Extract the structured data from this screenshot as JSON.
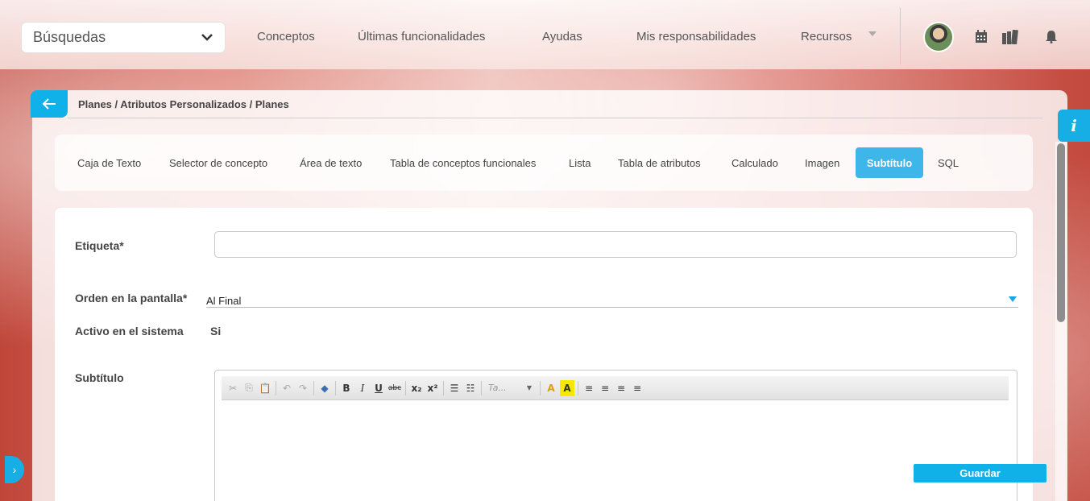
{
  "header": {
    "search_value": "Búsquedas",
    "nav": [
      {
        "label": "Conceptos"
      },
      {
        "label": "Últimas funcionalidades"
      },
      {
        "label": "Ayudas"
      },
      {
        "label": "Mis responsabilidades"
      },
      {
        "label": "Recursos"
      }
    ],
    "icons": [
      "chevron-down-icon",
      "avatar",
      "calendar-icon",
      "books-icon",
      "bell-icon"
    ]
  },
  "breadcrumb": "Planes / Atributos Personalizados / Planes",
  "tabs": [
    {
      "label": "Caja de Texto"
    },
    {
      "label": "Selector de concepto"
    },
    {
      "label": "Área de texto"
    },
    {
      "label": "Tabla de conceptos funcionales"
    },
    {
      "label": "Lista"
    },
    {
      "label": "Tabla de atributos"
    },
    {
      "label": "Calculado"
    },
    {
      "label": "Imagen"
    },
    {
      "label": "Subtítulo",
      "active": true
    },
    {
      "label": "SQL"
    }
  ],
  "form": {
    "etiqueta_label": "Etiqueta*",
    "etiqueta_value": "",
    "orden_label": "Orden en la pantalla*",
    "orden_value": "Al Final",
    "activo_label": "Activo en el sistema",
    "activo_value": "Si",
    "subtitulo_label": "Subtítulo",
    "editor_font_placeholder": "Ta..."
  },
  "save_label": "Guardar",
  "colors": {
    "accent": "#0fb1e8",
    "active_tab": "#3fb6ea"
  }
}
